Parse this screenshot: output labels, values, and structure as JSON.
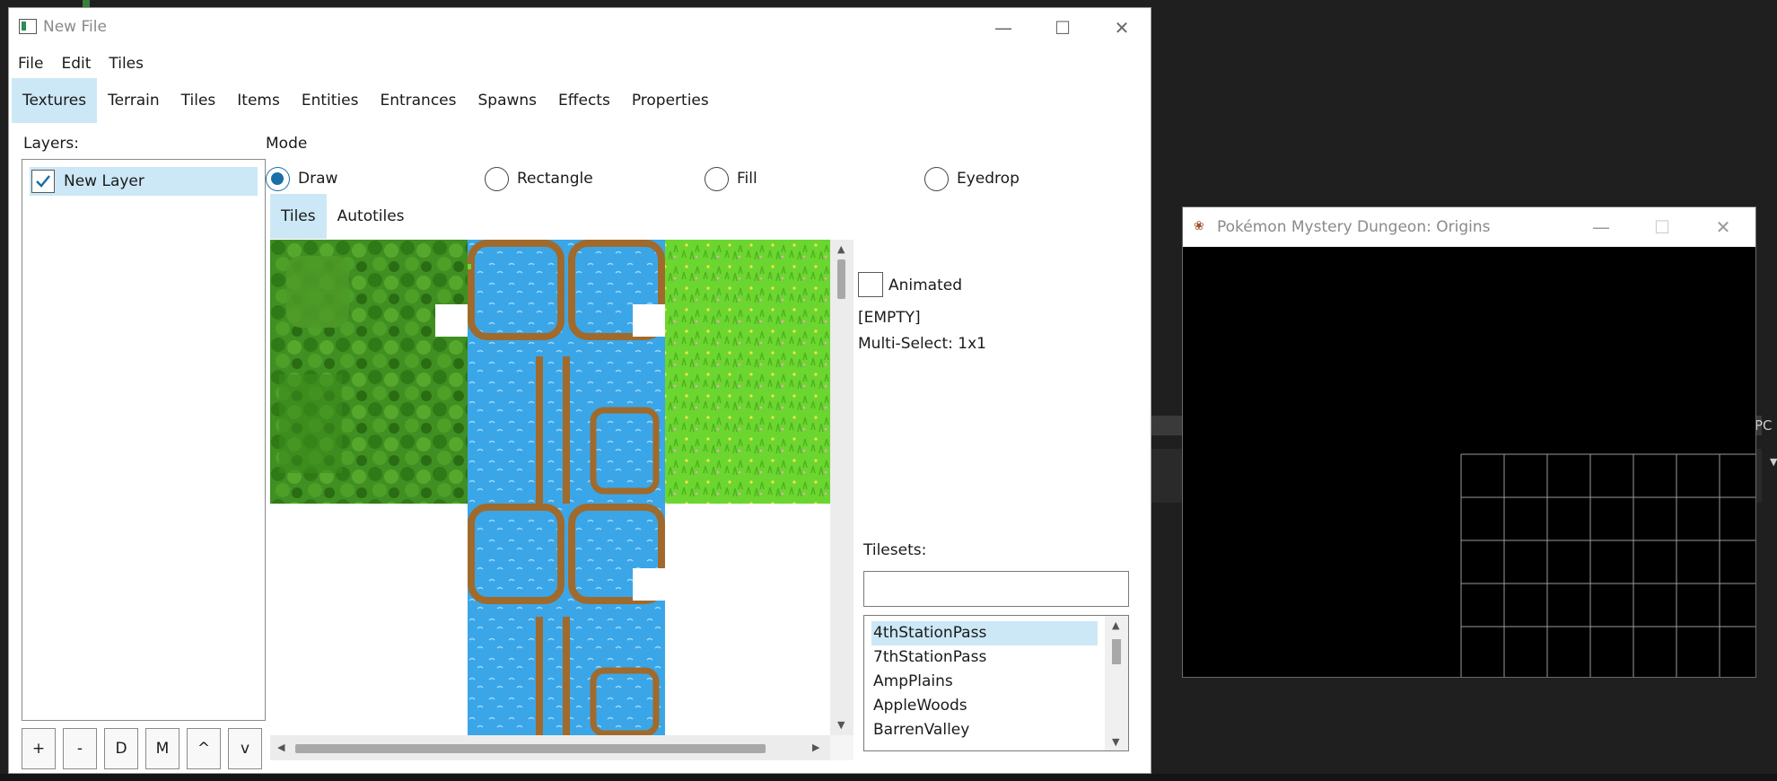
{
  "main_window": {
    "title": "New File",
    "controls": {
      "minimize": "—",
      "maximize": "☐",
      "close": "✕"
    }
  },
  "menubar": [
    "File",
    "Edit",
    "Tiles"
  ],
  "tabs": [
    {
      "label": "Textures",
      "active": true
    },
    {
      "label": "Terrain"
    },
    {
      "label": "Tiles"
    },
    {
      "label": "Items"
    },
    {
      "label": "Entities"
    },
    {
      "label": "Entrances"
    },
    {
      "label": "Spawns"
    },
    {
      "label": "Effects"
    },
    {
      "label": "Properties"
    }
  ],
  "layers": {
    "label": "Layers:",
    "items": [
      {
        "label": "New Layer",
        "visible": true,
        "selected": true
      }
    ],
    "buttons": [
      "+",
      "-",
      "D",
      "M",
      "^",
      "v"
    ]
  },
  "mode": {
    "label": "Mode",
    "options": [
      {
        "label": "Draw",
        "checked": true
      },
      {
        "label": "Rectangle"
      },
      {
        "label": "Fill"
      },
      {
        "label": "Eyedrop"
      }
    ]
  },
  "subtabs": [
    {
      "label": "Tiles",
      "active": true
    },
    {
      "label": "Autotiles"
    }
  ],
  "tile_info": {
    "animated_label": "Animated",
    "animated_checked": false,
    "empty_label": "[EMPTY]",
    "multiselect_label": "Multi-Select: 1x1"
  },
  "tilesets": {
    "label": "Tilesets:",
    "search_value": "",
    "items": [
      "4thStationPass",
      "7thStationPass",
      "AmpPlains",
      "AppleWoods",
      "BarrenValley"
    ],
    "selected_index": 0
  },
  "game_window": {
    "title": "Pokémon Mystery Dungeon: Origins",
    "controls": {
      "minimize": "—",
      "maximize": "☐",
      "close": "✕"
    }
  },
  "background": {
    "edge_text": "PC"
  },
  "colors": {
    "selection": "#cce8f6",
    "radio_accent": "#1a6fa8",
    "grass_dark": "#3f8f22",
    "grass_light": "#6cd630",
    "water": "#3aa6e8",
    "dirt_border": "#a06a2c"
  }
}
